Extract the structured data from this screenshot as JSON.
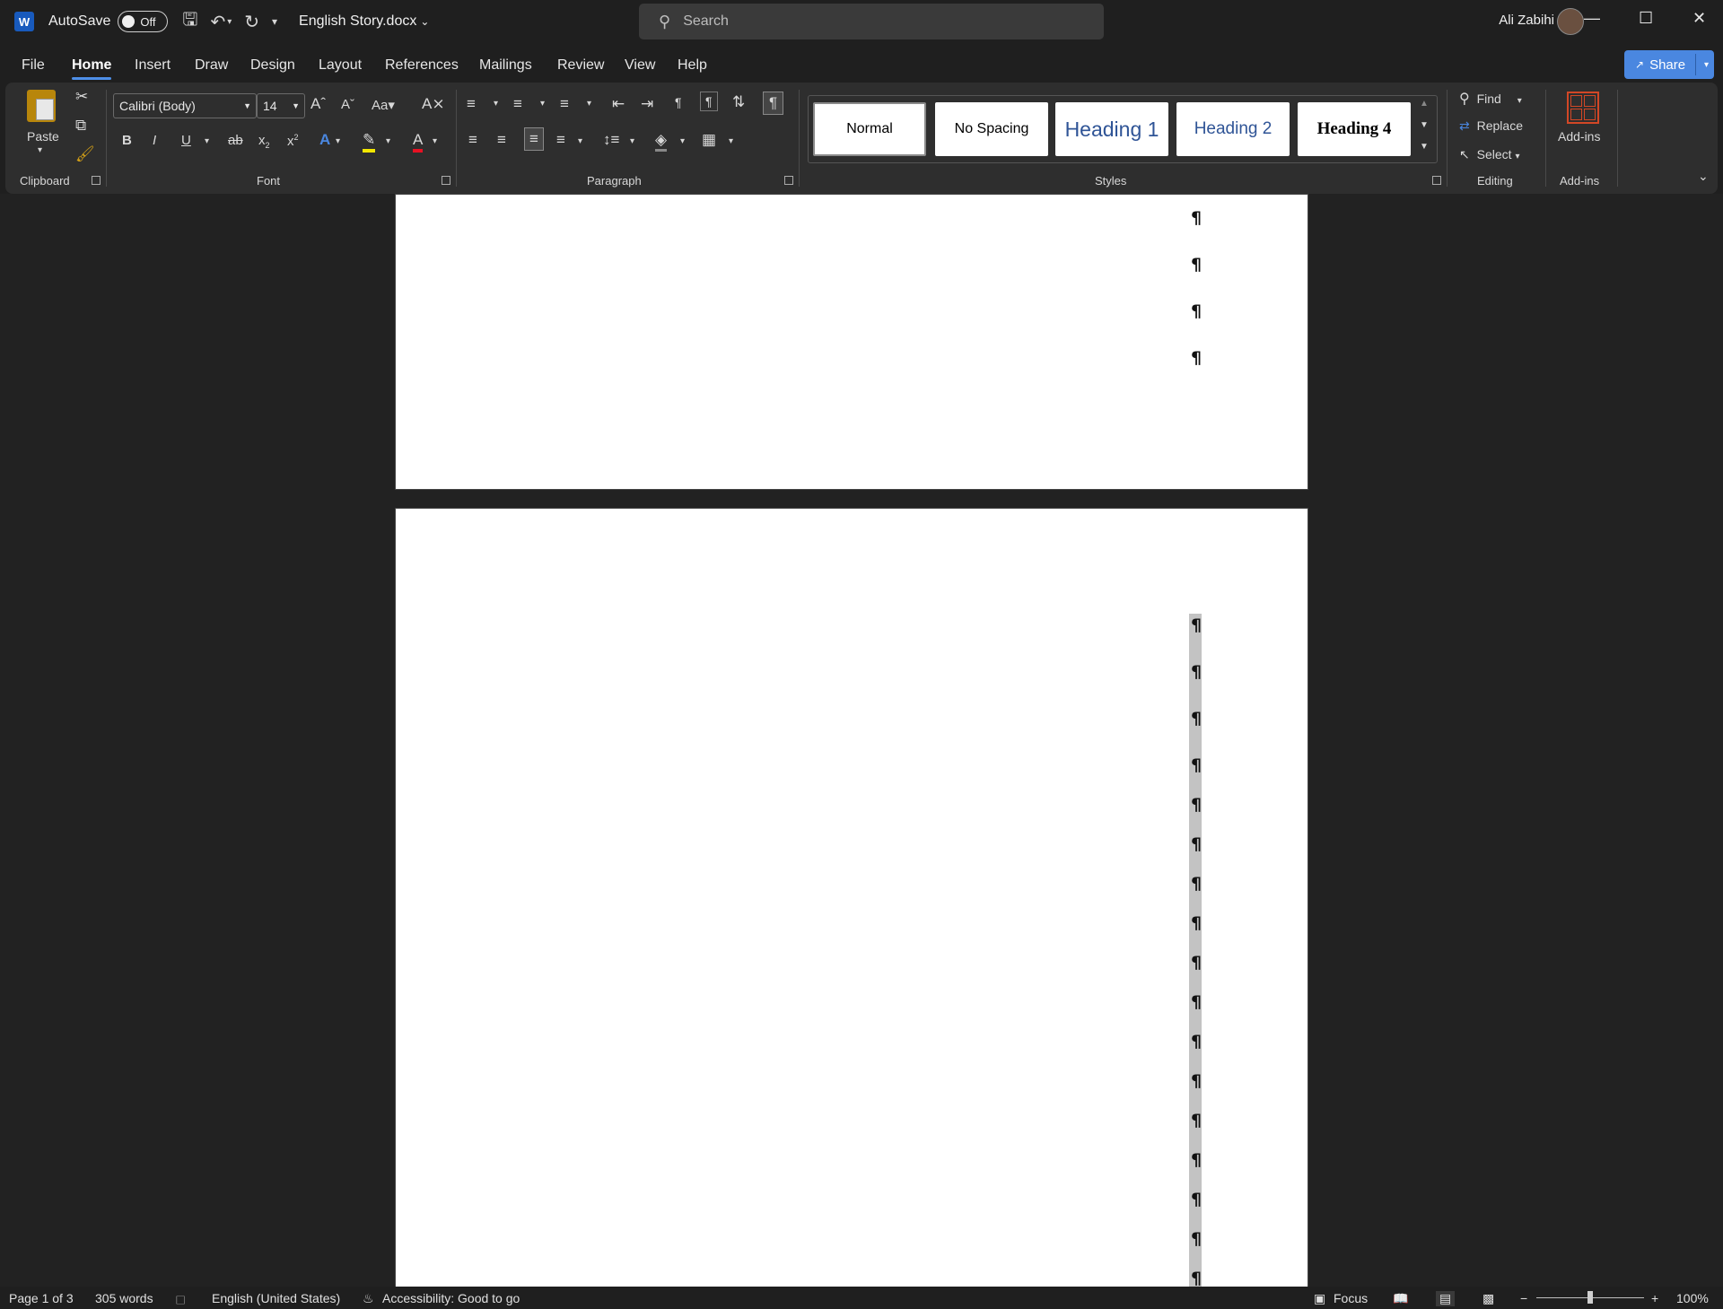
{
  "titlebar": {
    "app_icon": "word-icon",
    "autosave_label": "AutoSave",
    "autosave_state": "Off",
    "document_name": "English Story.docx",
    "search_placeholder": "Search",
    "user_name": "Ali Zabihi"
  },
  "menu": {
    "tabs": [
      "File",
      "Home",
      "Insert",
      "Draw",
      "Design",
      "Layout",
      "References",
      "Mailings",
      "Review",
      "View",
      "Help"
    ],
    "active_tab": "Home",
    "share_label": "Share"
  },
  "ribbon": {
    "clipboard": {
      "label": "Clipboard",
      "paste_label": "Paste"
    },
    "font": {
      "label": "Font",
      "font_name": "Calibri (Body)",
      "font_size": "14"
    },
    "paragraph": {
      "label": "Paragraph"
    },
    "styles": {
      "label": "Styles",
      "items": [
        "Normal",
        "No Spacing",
        "Heading 1",
        "Heading 2",
        "Heading 4"
      ]
    },
    "editing": {
      "label": "Editing",
      "find": "Find",
      "replace": "Replace",
      "select": "Select"
    },
    "addins": {
      "label": "Add-ins",
      "button": "Add-ins"
    }
  },
  "document": {
    "paragraph_mark": "¶"
  },
  "statusbar": {
    "page": "Page 1 of 3",
    "words": "305 words",
    "language": "English (United States)",
    "accessibility": "Accessibility: Good to go",
    "focus": "Focus",
    "zoom": "100%",
    "zoom_minus": "−",
    "zoom_plus": "+"
  },
  "colors": {
    "accent": "#4a87e0",
    "ribbon_bg": "#2e2e2e",
    "window_bg": "#1f1f1f"
  }
}
